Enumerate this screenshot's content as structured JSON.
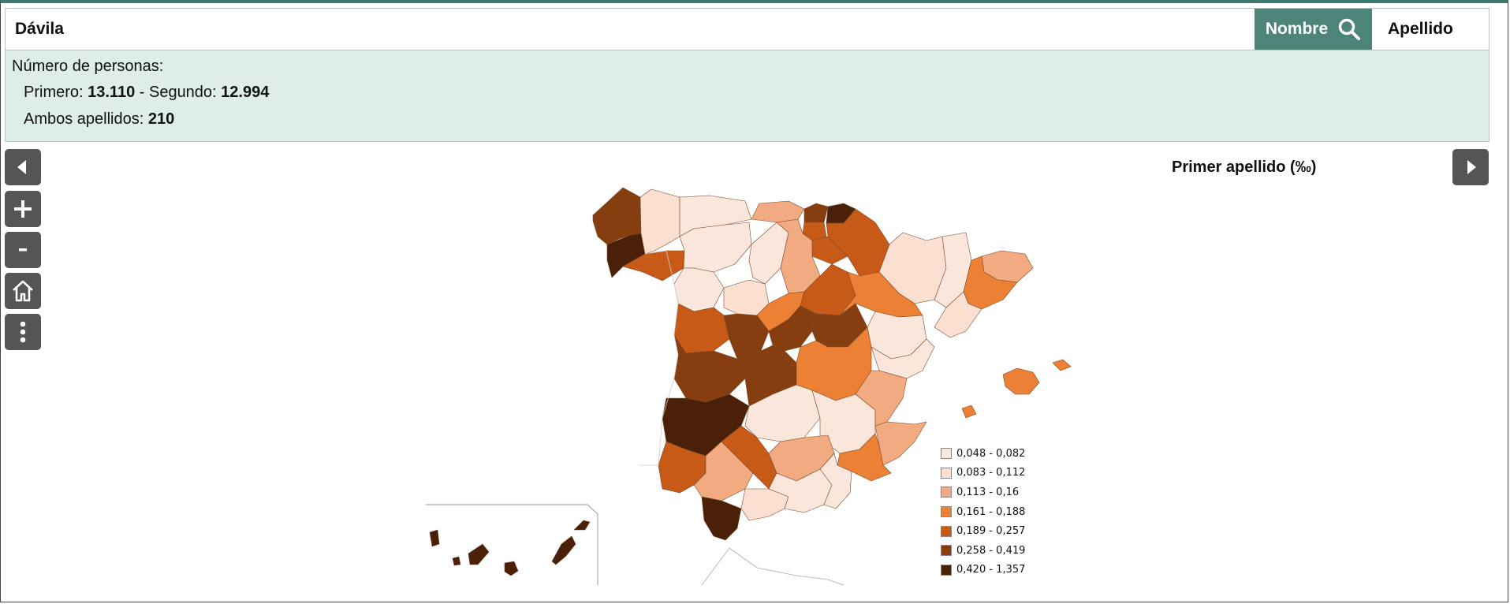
{
  "search": {
    "value": "Dávila"
  },
  "buttons": {
    "nombre": "Nombre",
    "apellido": "Apellido"
  },
  "info": {
    "title": "Número de personas:",
    "primero_label": "Primero: ",
    "primero_value": "13.110",
    "segundo_label": " - Segundo: ",
    "segundo_value": "12.994",
    "ambos_label": "Ambos apellidos: ",
    "ambos_value": "210"
  },
  "controls": [
    "prev-arrow-icon",
    "zoom-in-icon",
    "zoom-out-icon",
    "home-icon",
    "more-vertical-icon",
    "next-arrow-icon"
  ],
  "map": {
    "title": "Primer apellido (‰)",
    "legend": [
      {
        "label": "0,048 - 0,082",
        "color": "#fbe6dc"
      },
      {
        "label": "0,083 - 0,112",
        "color": "#fbe0d2"
      },
      {
        "label": "0,113 - 0,16",
        "color": "#f2ab80"
      },
      {
        "label": "0,161 - 0,188",
        "color": "#ec8135"
      },
      {
        "label": "0,189 - 0,257",
        "color": "#c85a18"
      },
      {
        "label": "0,258 - 0,419",
        "color": "#863d10"
      },
      {
        "label": "0,420 - 1,357",
        "color": "#4a2008"
      }
    ]
  },
  "colors": {
    "accent": "#4c8479",
    "info_bg": "#deedea",
    "control_bg": "#555555"
  }
}
